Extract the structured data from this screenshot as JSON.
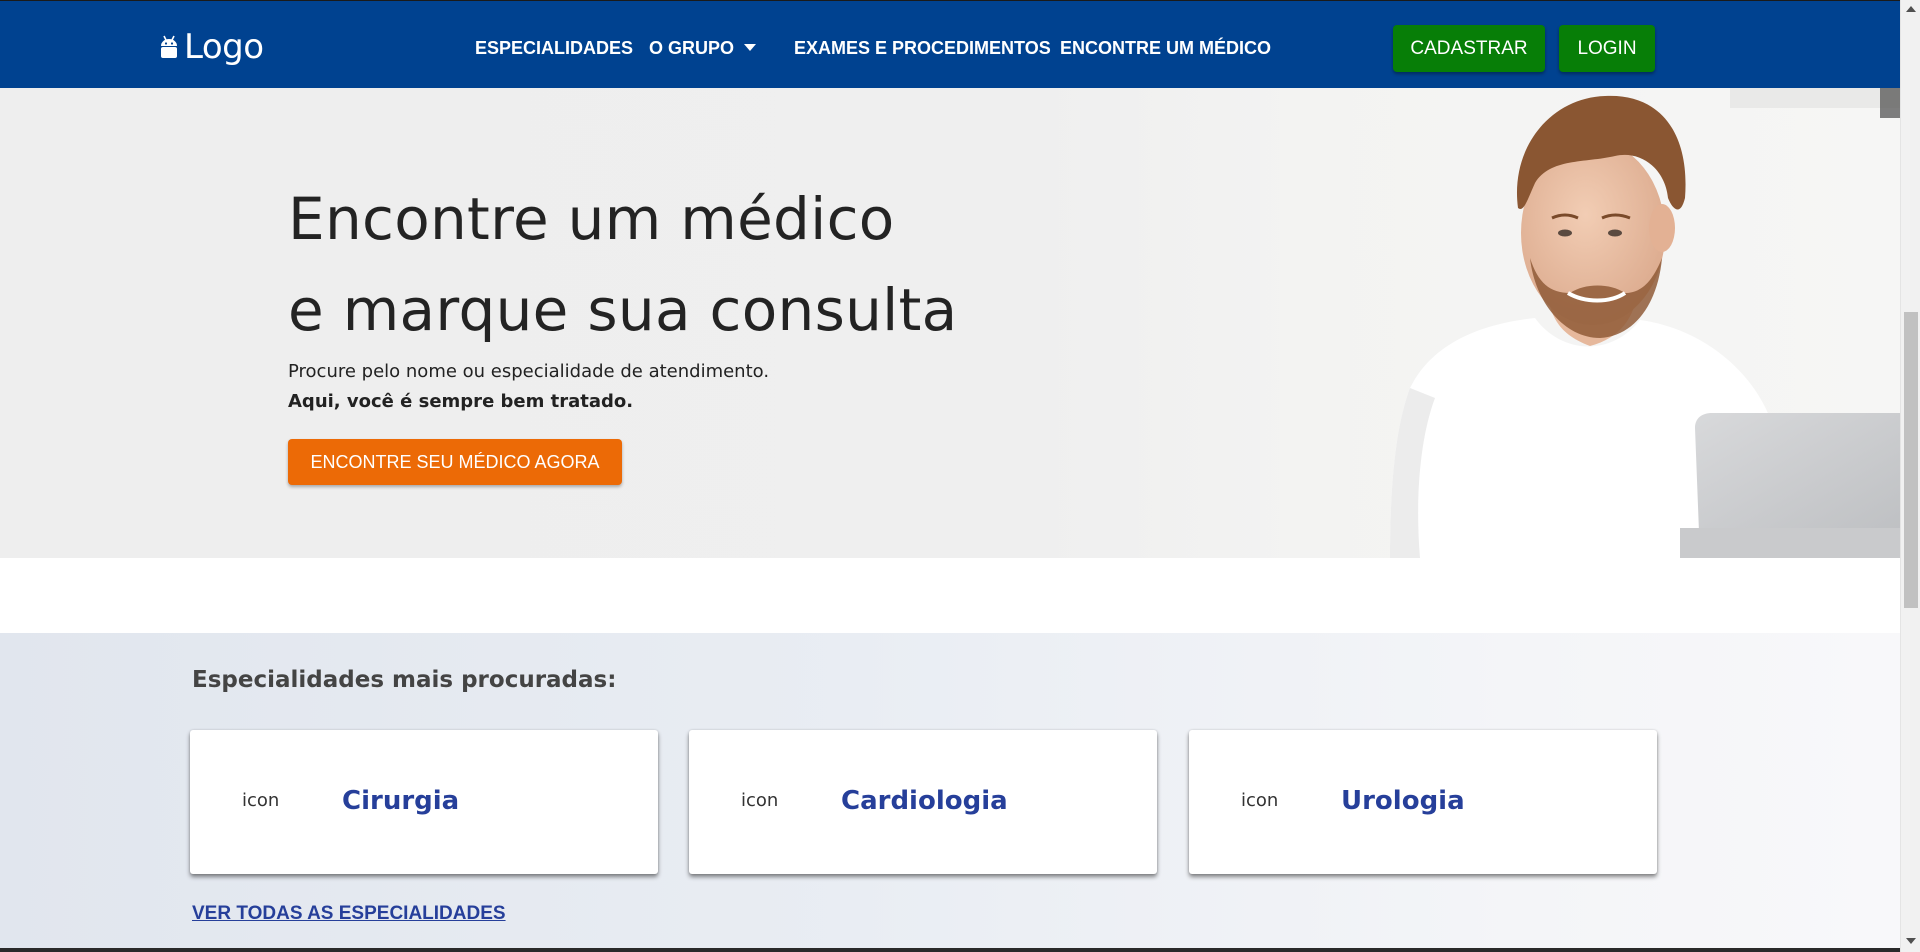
{
  "brand": {
    "logo_text": "Logo"
  },
  "nav": {
    "items": [
      {
        "label": "ESPECIALIDADES"
      },
      {
        "label": "O GRUPO",
        "has_dropdown": true
      },
      {
        "label": "EXAMES E PROCEDIMENTOS"
      },
      {
        "label": "ENCONTRE UM MÉDICO"
      }
    ],
    "signup_label": "CADASTRAR",
    "login_label": "LOGIN"
  },
  "hero": {
    "title_line1": "Encontre um médico",
    "title_line2": "e marque sua consulta",
    "subtitle": "Procure pelo nome ou especialidade de atendimento.",
    "tagline": "Aqui, você é sempre bem tratado.",
    "cta_label": "ENCONTRE SEU MÉDICO AGORA"
  },
  "specialties": {
    "heading": "Especialidades mais procuradas:",
    "cards": [
      {
        "icon_text": "icon",
        "name": "Cirurgia"
      },
      {
        "icon_text": "icon",
        "name": "Cardiologia"
      },
      {
        "icon_text": "icon",
        "name": "Urologia"
      }
    ],
    "view_all_label": "VER TODAS AS ESPECIALIDADES"
  },
  "colors": {
    "navbar": "#004290",
    "button_green": "#077e07",
    "button_orange": "#ec6a06",
    "specialty_text": "#263f9a"
  },
  "icons": {
    "logo_icon": "android-robot-icon",
    "dropdown_icon": "caret-down-icon"
  }
}
